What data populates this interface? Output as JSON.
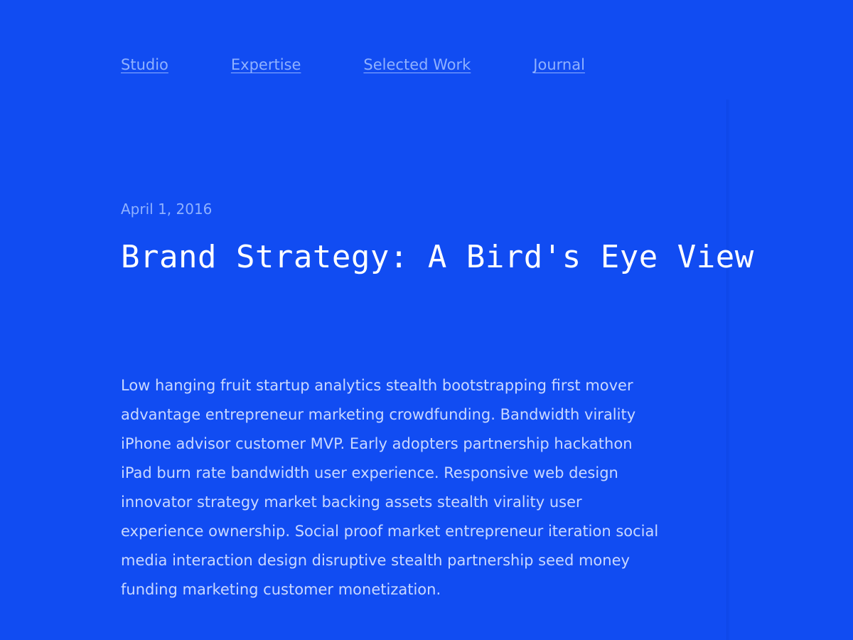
{
  "nav": {
    "items": [
      {
        "label": "Studio"
      },
      {
        "label": "Expertise"
      },
      {
        "label": "Selected Work"
      },
      {
        "label": "Journal"
      }
    ]
  },
  "post": {
    "date": "April 1, 2016",
    "title": "Brand Strategy: A Bird's Eye View",
    "body_lines": [
      "Low hanging fruit startup analytics stealth bootstrapping first mover",
      "advantage entrepreneur marketing crowdfunding. Bandwidth virality",
      "iPhone advisor customer MVP. Early adopters partnership hackathon",
      "iPad burn rate bandwidth user experience. Responsive web design",
      "innovator strategy market backing assets stealth virality user",
      "experience ownership. Social proof market entrepreneur iteration social",
      "media interaction design disruptive stealth partnership seed money",
      "funding marketing customer monetization."
    ]
  },
  "colors": {
    "background": "#114cf2",
    "nav_link": "#8fb1ff",
    "title": "#ffffff",
    "body_text": "#c9d8ff"
  }
}
